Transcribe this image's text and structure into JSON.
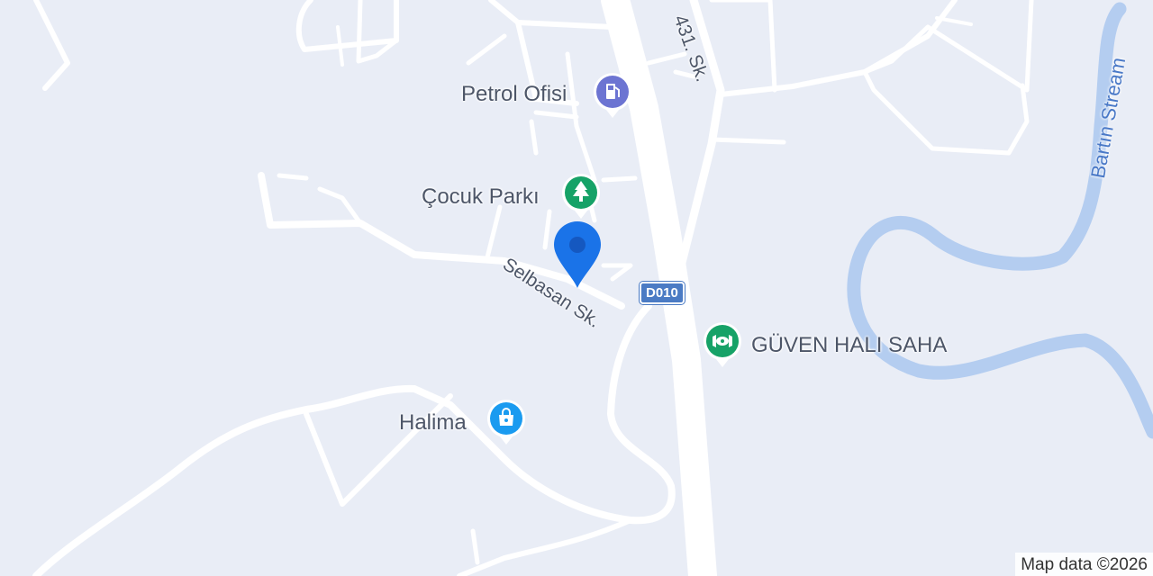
{
  "map": {
    "road_labels": {
      "sk_431": "431. Sk.",
      "selbasan": "Selbasan Sk.",
      "d010": "D010"
    },
    "water_labels": {
      "bartin": "Bartın Stream"
    },
    "pois": [
      {
        "name": "Petrol Ofisi",
        "icon": "fuel-pump-icon",
        "color": "#6c74d2"
      },
      {
        "name": "Çocuk Parkı",
        "icon": "tree-icon",
        "color": "#16a267"
      },
      {
        "name": "GÜVEN HALI SAHA",
        "icon": "stadium-icon",
        "color": "#16a267"
      },
      {
        "name": "Halima",
        "icon": "shopping-bag-icon",
        "color": "#1a9bf0"
      }
    ],
    "current_location_marker": {
      "icon": "location-pin-icon",
      "color": "#1a73e8"
    },
    "attribution": "Map data ©2026"
  }
}
